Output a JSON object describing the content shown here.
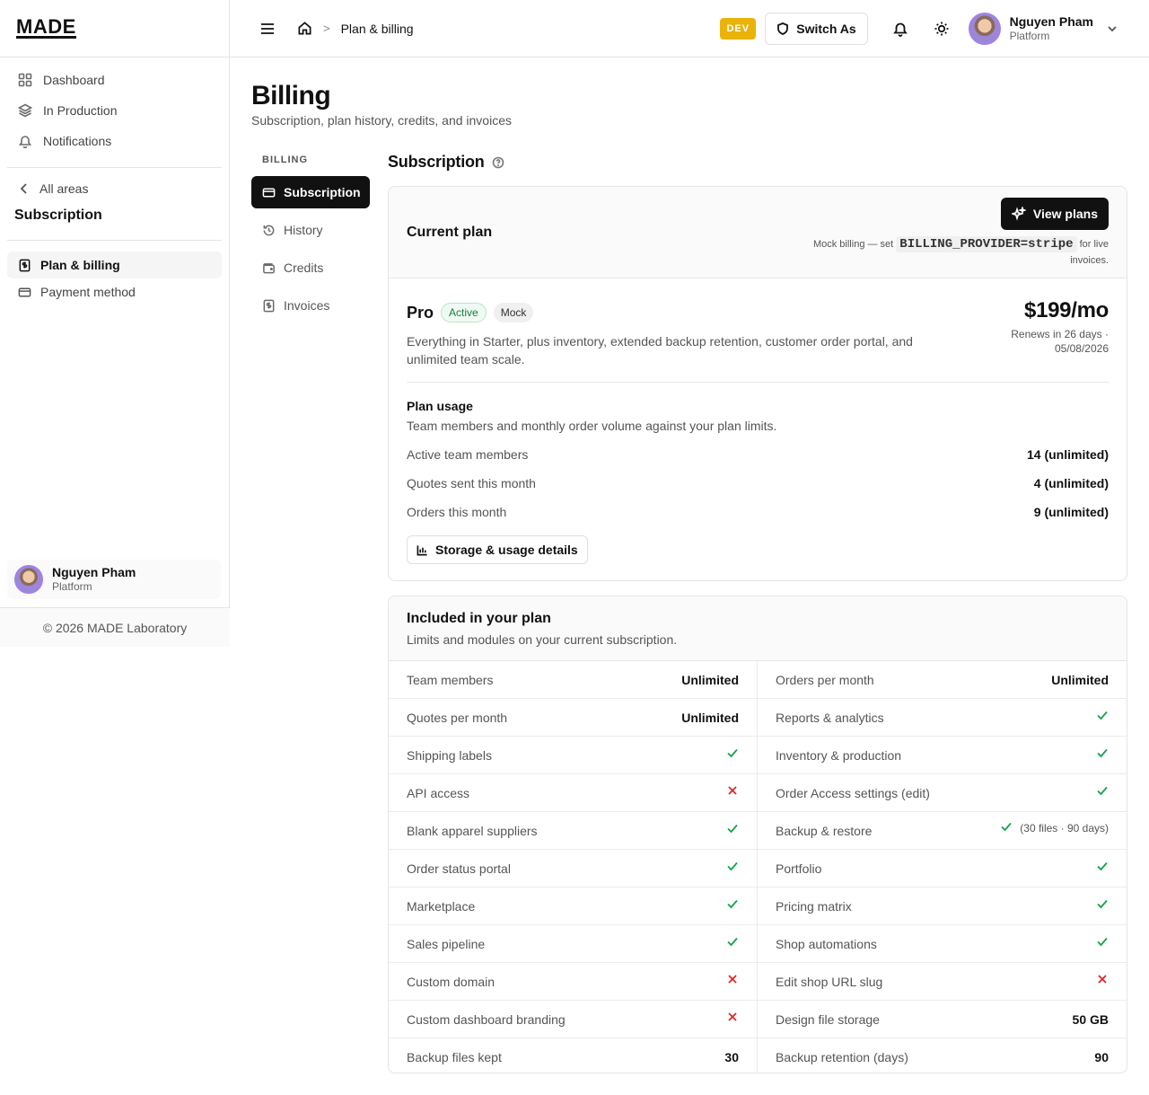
{
  "app": {
    "logo": "MADE"
  },
  "sidebar": {
    "nav": [
      {
        "label": "Dashboard",
        "icon": "dashboard-icon"
      },
      {
        "label": "In Production",
        "icon": "layers-icon"
      },
      {
        "label": "Notifications",
        "icon": "bell-icon"
      }
    ],
    "back_label": "All areas",
    "section_title": "Subscription",
    "sub_items": [
      {
        "label": "Plan & billing",
        "icon": "receipt-icon",
        "active": true
      },
      {
        "label": "Payment method",
        "icon": "credit-card-icon",
        "active": false
      }
    ],
    "user": {
      "name": "Nguyen Pham",
      "role": "Platform"
    },
    "copyright": "© 2026 MADE Laboratory"
  },
  "topbar": {
    "breadcrumb": "Plan & billing",
    "env_badge": "DEV",
    "switch_as": "Switch As",
    "user": {
      "name": "Nguyen Pham",
      "role": "Platform"
    }
  },
  "page": {
    "title": "Billing",
    "subtitle": "Subscription, plan history, credits, and invoices"
  },
  "billing_nav": {
    "label": "BILLING",
    "items": [
      {
        "label": "Subscription",
        "icon": "credit-card-icon",
        "active": true
      },
      {
        "label": "History",
        "icon": "history-icon",
        "active": false
      },
      {
        "label": "Credits",
        "icon": "wallet-icon",
        "active": false
      },
      {
        "label": "Invoices",
        "icon": "receipt-icon",
        "active": false
      }
    ]
  },
  "subscription": {
    "heading": "Subscription",
    "current_plan_title": "Current plan",
    "view_plans": "View plans",
    "mock_note_prefix": "Mock billing — set",
    "mock_note_code": "BILLING_PROVIDER=stripe",
    "mock_note_suffix": "for live invoices.",
    "plan": {
      "name": "Pro",
      "status": "Active",
      "mode": "Mock",
      "price": "$199/mo",
      "renewal": "Renews in 26 days · 05/08/2026",
      "description": "Everything in Starter, plus inventory, extended backup retention, customer order portal, and unlimited team scale."
    },
    "usage": {
      "title": "Plan usage",
      "subtitle": "Team members and monthly order volume against your plan limits.",
      "rows": [
        {
          "label": "Active team members",
          "value": "14 (unlimited)"
        },
        {
          "label": "Quotes sent this month",
          "value": "4 (unlimited)"
        },
        {
          "label": "Orders this month",
          "value": "9 (unlimited)"
        }
      ],
      "details_button": "Storage & usage details"
    }
  },
  "included": {
    "title": "Included in your plan",
    "subtitle": "Limits and modules on your current subscription.",
    "rows": [
      [
        {
          "label": "Team members",
          "value": "Unlimited",
          "kind": "text"
        },
        {
          "label": "Orders per month",
          "value": "Unlimited",
          "kind": "text"
        }
      ],
      [
        {
          "label": "Quotes per month",
          "value": "Unlimited",
          "kind": "text"
        },
        {
          "label": "Reports & analytics",
          "kind": "check"
        }
      ],
      [
        {
          "label": "Shipping labels",
          "kind": "check"
        },
        {
          "label": "Inventory & production",
          "kind": "check"
        }
      ],
      [
        {
          "label": "API access",
          "kind": "cross"
        },
        {
          "label": "Order Access settings (edit)",
          "kind": "check"
        }
      ],
      [
        {
          "label": "Blank apparel suppliers",
          "kind": "check"
        },
        {
          "label": "Backup & restore",
          "kind": "check-detail",
          "value": "(30 files · 90 days)"
        }
      ],
      [
        {
          "label": "Order status portal",
          "kind": "check"
        },
        {
          "label": "Portfolio",
          "kind": "check"
        }
      ],
      [
        {
          "label": "Marketplace",
          "kind": "check"
        },
        {
          "label": "Pricing matrix",
          "kind": "check"
        }
      ],
      [
        {
          "label": "Sales pipeline",
          "kind": "check"
        },
        {
          "label": "Shop automations",
          "kind": "check"
        }
      ],
      [
        {
          "label": "Custom domain",
          "kind": "cross"
        },
        {
          "label": "Edit shop URL slug",
          "kind": "cross"
        }
      ],
      [
        {
          "label": "Custom dashboard branding",
          "kind": "cross"
        },
        {
          "label": "Design file storage",
          "value": "50 GB",
          "kind": "text"
        }
      ],
      [
        {
          "label": "Backup files kept",
          "value": "30",
          "kind": "text"
        },
        {
          "label": "Backup retention (days)",
          "value": "90",
          "kind": "text"
        }
      ]
    ]
  }
}
